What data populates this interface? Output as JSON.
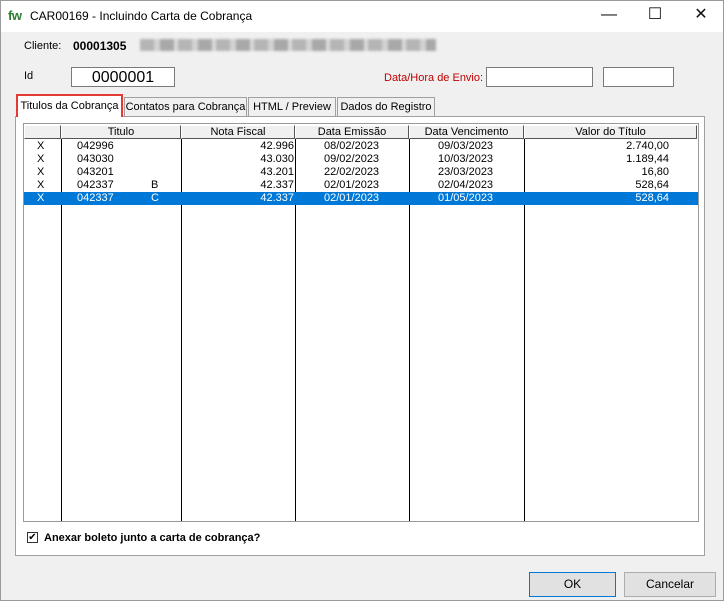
{
  "window": {
    "app_logo": "fw",
    "title": "CAR00169  - Incluindo Carta de Cobrança",
    "minimize_glyph": "—",
    "maximize_glyph": "☐",
    "close_glyph": "✕"
  },
  "client": {
    "label": "Cliente:",
    "code": "00001305"
  },
  "record": {
    "id_label": "Id",
    "id_value": "0000001",
    "send_label": "Data/Hora de Envio:",
    "send_date": "",
    "send_time": ""
  },
  "tabs": [
    {
      "label": "Titulos da Cobrança",
      "active": true
    },
    {
      "label": "Contatos para Cobrança",
      "active": false
    },
    {
      "label": "HTML / Preview",
      "active": false
    },
    {
      "label": "Dados do Registro",
      "active": false
    }
  ],
  "grid": {
    "columns": [
      "Titulo",
      "Nota Fiscal",
      "Data Emissão",
      "Data Vencimento",
      "Valor do Título"
    ],
    "rows": [
      {
        "mark": "X",
        "titulo": "042996",
        "suffix": "",
        "nota": "42.996",
        "emissao": "08/02/2023",
        "vencimento": "09/03/2023",
        "valor": "2.740,00",
        "selected": false
      },
      {
        "mark": "X",
        "titulo": "043030",
        "suffix": "",
        "nota": "43.030",
        "emissao": "09/02/2023",
        "vencimento": "10/03/2023",
        "valor": "1.189,44",
        "selected": false
      },
      {
        "mark": "X",
        "titulo": "043201",
        "suffix": "",
        "nota": "43.201",
        "emissao": "22/02/2023",
        "vencimento": "23/03/2023",
        "valor": "16,80",
        "selected": false
      },
      {
        "mark": "X",
        "titulo": "042337",
        "suffix": "B",
        "nota": "42.337",
        "emissao": "02/01/2023",
        "vencimento": "02/04/2023",
        "valor": "528,64",
        "selected": false
      },
      {
        "mark": "X",
        "titulo": "042337",
        "suffix": "C",
        "nota": "42.337",
        "emissao": "02/01/2023",
        "vencimento": "01/05/2023",
        "valor": "528,64",
        "selected": true
      }
    ]
  },
  "attach_boleto": {
    "label": "Anexar boleto junto a carta de cobrança?",
    "checked": true,
    "check_glyph": "✔"
  },
  "buttons": {
    "ok": "OK",
    "cancel": "Cancelar"
  }
}
